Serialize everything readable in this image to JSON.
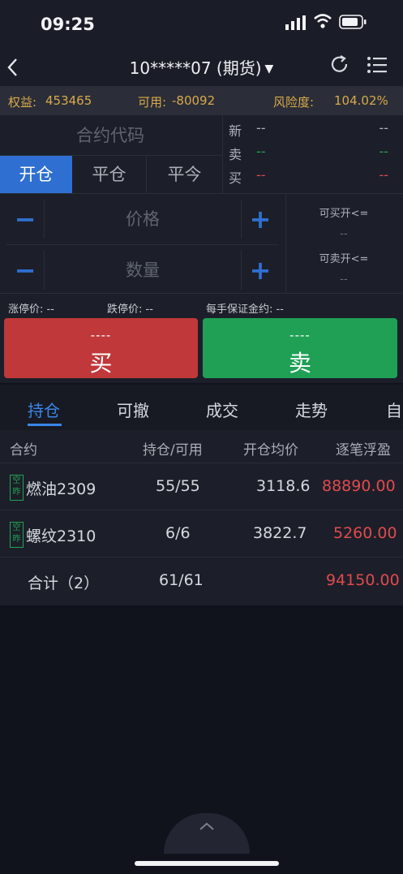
{
  "status": {
    "time": "09:25"
  },
  "nav": {
    "account": "10*****07 (期货)"
  },
  "account": {
    "equity_label": "权益:",
    "equity": "453465",
    "avail_label": "可用:",
    "avail": "-80092",
    "risk_label": "风险度:",
    "risk": "104.02%"
  },
  "order": {
    "contract_placeholder": "合约代码",
    "quotes": [
      {
        "label": "新",
        "mid": "--",
        "right": "--",
        "color": "#aeb2bb"
      },
      {
        "label": "卖",
        "mid": "--",
        "right": "--",
        "color": "#22a353"
      },
      {
        "label": "买",
        "mid": "--",
        "right": "--",
        "color": "#e04a4e"
      }
    ],
    "tabs": [
      "开仓",
      "平仓",
      "平今"
    ],
    "active_tab": 0,
    "price_label": "价格",
    "qty_label": "数量",
    "minus": "−",
    "plus": "+",
    "can_buy_label": "可买开<=",
    "can_buy": "--",
    "can_sell_label": "可卖开<=",
    "can_sell": "--",
    "limit_up": "涨停价: --",
    "limit_down": "跌停价: --",
    "margin": "每手保证金约: --",
    "buy_price": "----",
    "buy_label": "买",
    "sell_price": "----",
    "sell_label": "卖"
  },
  "tabs": [
    "持仓",
    "可撤",
    "成交",
    "走势",
    "自"
  ],
  "table": {
    "headers": [
      "合约",
      "持仓/可用",
      "开仓均价",
      "逐笔浮盈"
    ],
    "rows": [
      {
        "tag": "空昨",
        "name": "燃油2309",
        "qty": "55/55",
        "avg": "3118.6",
        "pnl": "88890.00"
      },
      {
        "tag": "空昨",
        "name": "螺纹2310",
        "qty": "6/6",
        "avg": "3822.7",
        "pnl": "5260.00"
      }
    ],
    "total": {
      "label": "合计（2）",
      "qty": "61/61",
      "pnl": "94150.00"
    }
  },
  "colors": {
    "accent": "#2f6fd1",
    "buy": "#c0383a",
    "sell": "#20a055",
    "profit": "#e04a4e",
    "warning": "#d8a94b"
  }
}
